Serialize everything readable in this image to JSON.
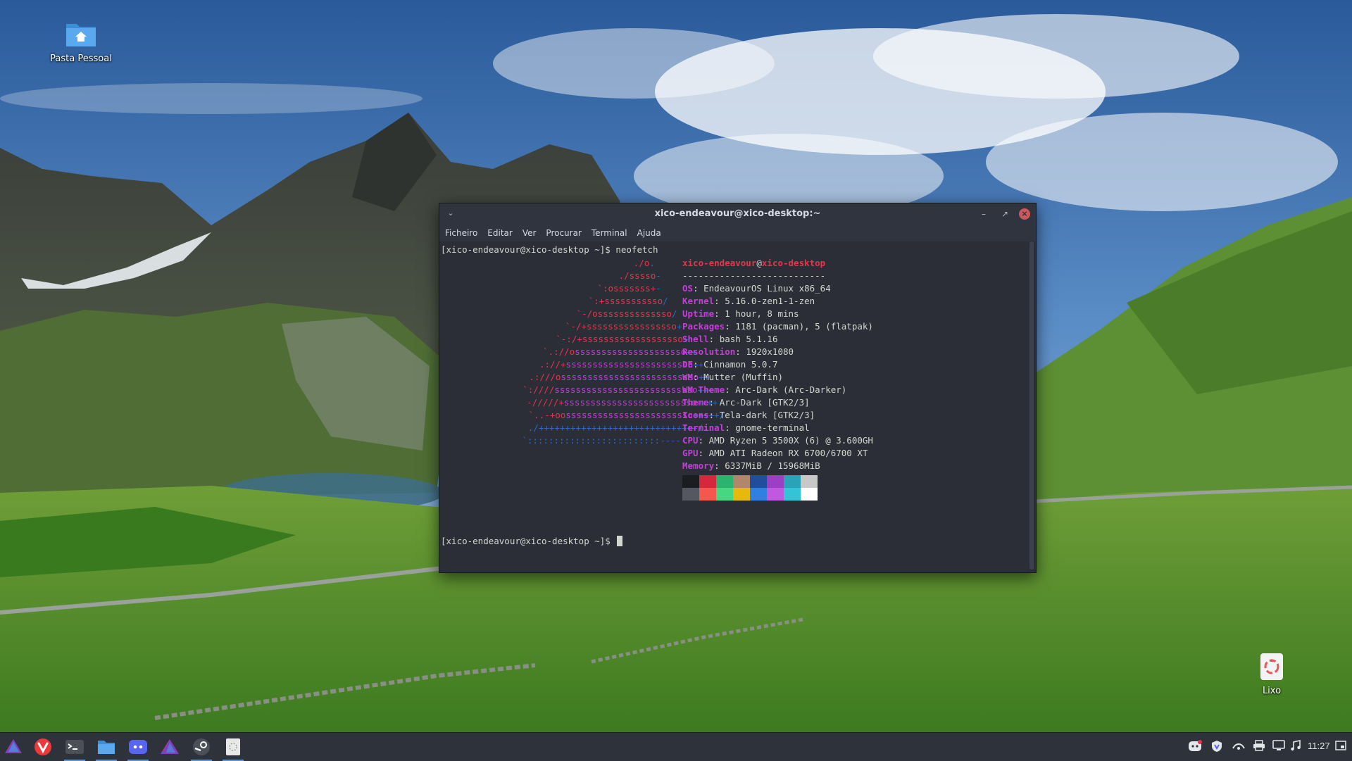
{
  "desktop": {
    "icons": [
      {
        "label": "Pasta Pessoal",
        "icon": "home-folder-icon"
      },
      {
        "label": "Lixo",
        "icon": "trash-icon"
      }
    ]
  },
  "terminal": {
    "title": "xico-endeavour@xico-desktop:~",
    "menu": [
      "Ficheiro",
      "Editar",
      "Ver",
      "Procurar",
      "Terminal",
      "Ajuda"
    ],
    "prompt_cmd": "[xico-endeavour@xico-desktop ~]$ neofetch",
    "prompt_end": "[xico-endeavour@xico-desktop ~]$ ",
    "logo": [
      {
        "red": "./o",
        "mag": "",
        "blue": "."
      },
      {
        "red": "./sssso",
        "mag": "",
        "blue": "-"
      },
      {
        "red": "`:osssssss+",
        "mag": "",
        "blue": "-"
      },
      {
        "red": "`:+sssssssssso",
        "mag": "",
        "blue": "/"
      },
      {
        "red": "`-/ossssssssssssso",
        "mag": "",
        "blue": "/"
      },
      {
        "red": "`-/+sssssssssssssssso",
        "mag": "",
        "blue": "+"
      },
      {
        "red": "`-:/+sssssssssssssssssso",
        "mag": "",
        "blue": "+"
      },
      {
        "red": "`.://o",
        "mag": "sssssssssssssssssssso",
        "blue": "++"
      },
      {
        "red": ".://+",
        "mag": "ssssssssssssssssssssssso",
        "blue": "++"
      },
      {
        "red": ".:///o",
        "mag": "ssssssssssssssssssssssssso",
        "blue": "++"
      },
      {
        "red": "`:////",
        "mag": "sssssssssssssssssssssssssso",
        "blue": "+++"
      },
      {
        "red": "-/////+",
        "mag": "sssssssssssssssssssssssso",
        "blue": "++++"
      },
      {
        "red": "`..-+oo",
        "mag": "ssssssssssssssssssssssso",
        "blue": "+++++/"
      },
      {
        "red": "",
        "mag": "",
        "blue": "./++++++++++++++++++++++++++++++/:."
      },
      {
        "red": "",
        "mag": "",
        "blue": "`:::::::::::::::::::::::::------``"
      }
    ],
    "header_user": "xico-endeavour",
    "header_at": "@",
    "header_host": "xico-desktop",
    "separator": "---------------------------",
    "info": [
      {
        "label": "OS",
        "value": ": EndeavourOS Linux x86_64"
      },
      {
        "label": "Kernel",
        "value": ": 5.16.0-zen1-1-zen"
      },
      {
        "label": "Uptime",
        "value": ": 1 hour, 8 mins"
      },
      {
        "label": "Packages",
        "value": ": 1181 (pacman), 5 (flatpak)"
      },
      {
        "label": "Shell",
        "value": ": bash 5.1.16"
      },
      {
        "label": "Resolution",
        "value": ": 1920x1080"
      },
      {
        "label": "DE",
        "value": ": Cinnamon 5.0.7"
      },
      {
        "label": "WM",
        "value": ": Mutter (Muffin)"
      },
      {
        "label": "WM Theme",
        "value": ": Arc-Dark (Arc-Darker)"
      },
      {
        "label": "Theme",
        "value": ": Arc-Dark [GTK2/3]"
      },
      {
        "label": "Icons",
        "value": ": Tela-dark [GTK2/3]"
      },
      {
        "label": "Terminal",
        "value": ": gnome-terminal"
      },
      {
        "label": "CPU",
        "value": ": AMD Ryzen 5 3500X (6) @ 3.600GH"
      },
      {
        "label": "GPU",
        "value": ": AMD ATI Radeon RX 6700/6700 XT"
      },
      {
        "label": "Memory",
        "value": ": 6337MiB / 15968MiB"
      }
    ],
    "palette_top": [
      "#1c1d21",
      "#d6283c",
      "#2bb36f",
      "#b0876a",
      "#1f4f9c",
      "#9b40c4",
      "#2aa3b8",
      "#c8c8c8"
    ],
    "palette_bottom": [
      "#555861",
      "#f5574f",
      "#47d781",
      "#e7b90f",
      "#2f80e1",
      "#c059df",
      "#33c4d8",
      "#ffffff"
    ]
  },
  "taskbar": {
    "apps": [
      "endeavour-menu-icon",
      "vivaldi-icon",
      "terminal-icon",
      "file-manager-icon",
      "discord-icon",
      "endeavour-welcome-icon",
      "steam-icon",
      "notes-icon"
    ],
    "tray": [
      "discord-tray-icon",
      "vpn-shield-icon",
      "network-icon",
      "printer-icon",
      "display-icon",
      "music-icon"
    ],
    "clock": "11:27",
    "colors": {
      "accent": "#5294e2",
      "panel": "#2d323b"
    }
  }
}
